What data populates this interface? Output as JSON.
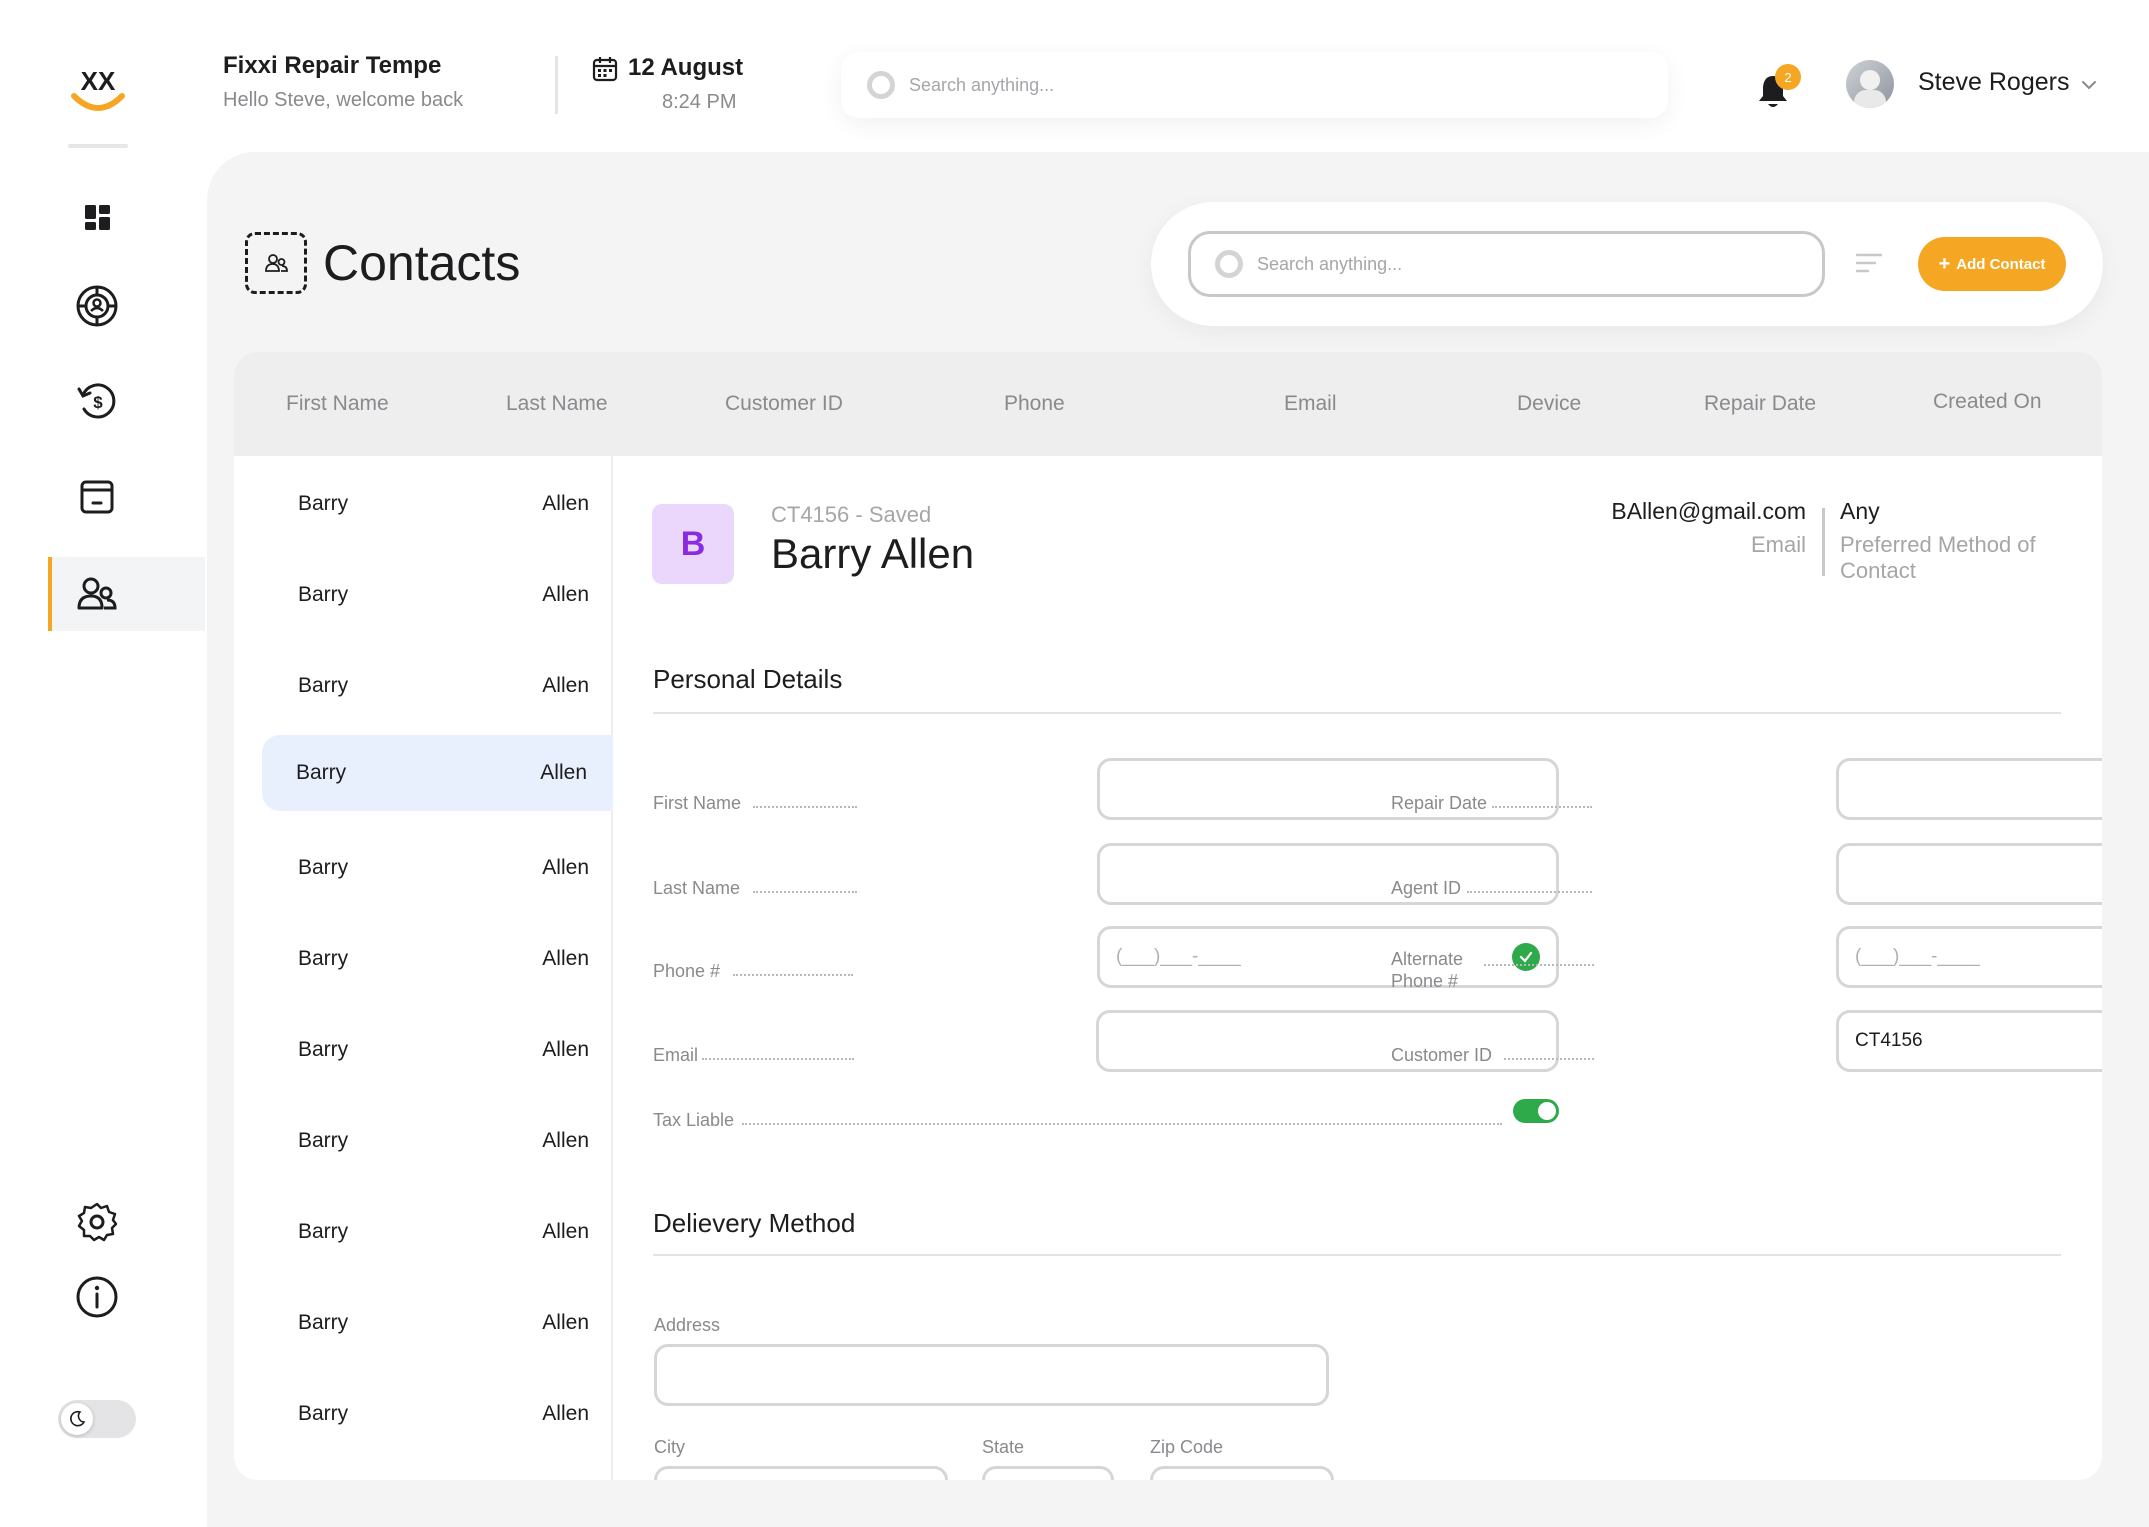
{
  "topbar": {
    "store_title": "Fixxi Repair Tempe",
    "welcome": "Hello Steve, welcome back",
    "date": "12 August",
    "time": "8:24 PM",
    "search_placeholder": "Search anything...",
    "notification_count": "2",
    "user_name": "Steve Rogers"
  },
  "sidebar": {
    "items": [
      {
        "name": "dashboard",
        "icon": "grid-icon"
      },
      {
        "name": "repairs",
        "icon": "target-icon"
      },
      {
        "name": "refunds",
        "icon": "dollar-cycle-icon"
      },
      {
        "name": "inventory",
        "icon": "box-icon"
      },
      {
        "name": "contacts",
        "icon": "users-icon",
        "active": true
      }
    ],
    "bottom": [
      {
        "name": "settings",
        "icon": "gear-icon"
      },
      {
        "name": "info",
        "icon": "info-icon"
      }
    ],
    "dark_mode": false
  },
  "page": {
    "title": "Contacts",
    "search_placeholder": "Search anything...",
    "add_button": "Add Contact"
  },
  "table": {
    "headers": [
      "First Name",
      "Last Name",
      "Customer ID",
      "Phone",
      "Email",
      "Device",
      "Repair Date",
      "Created On"
    ],
    "rows": [
      {
        "first": "Barry",
        "last": "Allen"
      },
      {
        "first": "Barry",
        "last": "Allen"
      },
      {
        "first": "Barry",
        "last": "Allen"
      },
      {
        "first": "Barry",
        "last": "Allen",
        "selected": true
      },
      {
        "first": "Barry",
        "last": "Allen"
      },
      {
        "first": "Barry",
        "last": "Allen"
      },
      {
        "first": "Barry",
        "last": "Allen"
      },
      {
        "first": "Barry",
        "last": "Allen"
      },
      {
        "first": "Barry",
        "last": "Allen"
      },
      {
        "first": "Barry",
        "last": "Allen"
      },
      {
        "first": "Barry",
        "last": "Allen"
      }
    ]
  },
  "detail": {
    "initial": "B",
    "status": "CT4156 - Saved",
    "name": "Barry Allen",
    "email": "BAllen@gmail.com",
    "email_label": "Email",
    "preferred": "Any",
    "preferred_label": "Preferred Method of Contact",
    "personal_title": "Personal Details",
    "delivery_title": "Delievery Method",
    "fields": {
      "first_name": {
        "label": "First Name",
        "value": ""
      },
      "last_name": {
        "label": "Last Name",
        "value": ""
      },
      "phone": {
        "label": "Phone #",
        "placeholder": "(___)___-____"
      },
      "email": {
        "label": "Email",
        "value": ""
      },
      "tax_liable": {
        "label": "Tax Liable",
        "on": true
      },
      "repair_date": {
        "label": "Repair Date",
        "value": ""
      },
      "agent_id": {
        "label": "Agent ID",
        "value": ""
      },
      "alt_phone": {
        "label": "Alternate Phone #",
        "placeholder": "(___)___-____"
      },
      "customer_id": {
        "label": "Customer ID",
        "value": "CT4156"
      },
      "address": {
        "label": "Address",
        "value": ""
      },
      "city": {
        "label": "City",
        "value": ""
      },
      "state": {
        "label": "State",
        "value": ""
      },
      "zip": {
        "label": "Zip Code",
        "value": ""
      }
    }
  },
  "colors": {
    "accent": "#f5a623",
    "success": "#2eaa4a",
    "selected_row": "#e8f0fd",
    "initial_bg": "#ead7fb",
    "initial_fg": "#8a2be2"
  }
}
